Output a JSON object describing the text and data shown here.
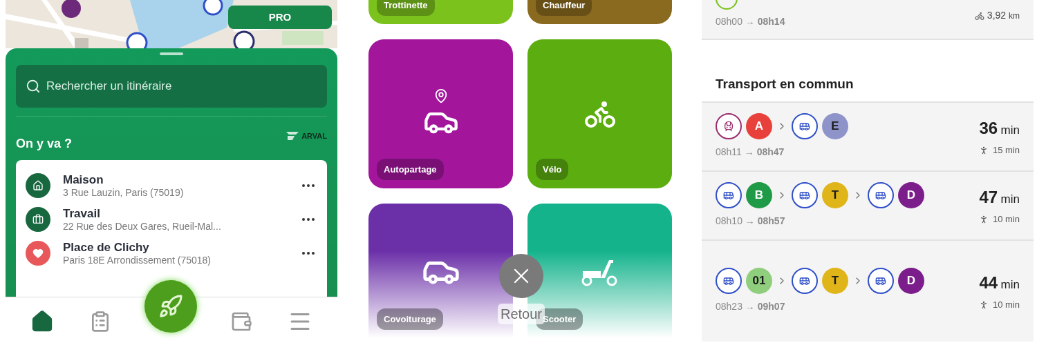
{
  "pro_button": "PRO",
  "sheet": {
    "search": {
      "placeholder": "Rechercher un itinéraire"
    },
    "heading": "On y va ?",
    "partner_logo": "ARVAL",
    "places": [
      {
        "kind": "home",
        "name": "Maison",
        "address": "3 Rue Lauzin, Paris (75019)",
        "color": "#17673f"
      },
      {
        "kind": "work",
        "name": "Travail",
        "address": "22 Rue des Deux Gares, Rueil-Mal...",
        "color": "#17673f"
      },
      {
        "kind": "favorite",
        "name": "Place de Clichy",
        "address": "Paris 18E Arrondissement (75018)",
        "color": "#e8585a"
      }
    ]
  },
  "nav": [
    {
      "kind": "home",
      "selected": true
    },
    {
      "kind": "list",
      "selected": false
    },
    {
      "kind": "rocket",
      "selected": false
    },
    {
      "kind": "wallet",
      "selected": false
    },
    {
      "kind": "menu",
      "selected": false
    }
  ],
  "modes": {
    "tiles": [
      {
        "label": "Trottinette",
        "kind": "none",
        "color": "#7cc21d"
      },
      {
        "label": "Chauffeur",
        "kind": "none",
        "color": "#8a6a1e"
      },
      {
        "label": "Autopartage",
        "kind": "carshare",
        "color": "#a3169c"
      },
      {
        "label": "Vélo",
        "kind": "bike",
        "color": "#5cae10"
      },
      {
        "label": "Covoiturage",
        "kind": "carpool",
        "color": "#6b2fa8"
      },
      {
        "label": "Scooter",
        "kind": "scooter",
        "color": "#14b38c"
      }
    ],
    "close_label": "Retour"
  },
  "results": {
    "previous": {
      "times": "08h00 → **08h14**",
      "distance": "3,92",
      "distance_unit": "km",
      "color": "#7cc21d"
    },
    "section": "Transport en commun",
    "routes": [
      {
        "steps": [
          {
            "kind": "train",
            "color": "#9b2c6e"
          },
          {
            "kind": "line",
            "label": "A",
            "color": "#e8403a"
          },
          {
            "kind": "sep"
          },
          {
            "kind": "bus",
            "color": "#2f4fc8"
          },
          {
            "kind": "line",
            "label": "E",
            "color": "#8e93c9"
          }
        ],
        "times": "08h11 → **08h47**",
        "duration": "36",
        "duration_unit": "min",
        "walk": "15 min"
      },
      {
        "steps": [
          {
            "kind": "bus",
            "color": "#2f4fc8"
          },
          {
            "kind": "line",
            "label": "B",
            "color": "#1f9a46"
          },
          {
            "kind": "sep"
          },
          {
            "kind": "bus",
            "color": "#2f4fc8"
          },
          {
            "kind": "line",
            "label": "T",
            "color": "#e0b51a"
          },
          {
            "kind": "sep"
          },
          {
            "kind": "bus",
            "color": "#2f4fc8"
          },
          {
            "kind": "line",
            "label": "D",
            "color": "#7b1e8c"
          }
        ],
        "times": "08h10 → **08h57**",
        "duration": "47",
        "duration_unit": "min",
        "walk": "10 min"
      },
      {
        "steps": [
          {
            "kind": "bus",
            "color": "#2f4fc8"
          },
          {
            "kind": "line",
            "label": "01",
            "color": "#8fce7c"
          },
          {
            "kind": "sep"
          },
          {
            "kind": "bus",
            "color": "#2f4fc8"
          },
          {
            "kind": "line",
            "label": "T",
            "color": "#e0b51a"
          },
          {
            "kind": "sep"
          },
          {
            "kind": "bus",
            "color": "#2f4fc8"
          },
          {
            "kind": "line",
            "label": "D",
            "color": "#7b1e8c"
          }
        ],
        "times": "08h23 → **09h07**",
        "duration": "44",
        "duration_unit": "min",
        "walk": "10 min"
      }
    ]
  }
}
